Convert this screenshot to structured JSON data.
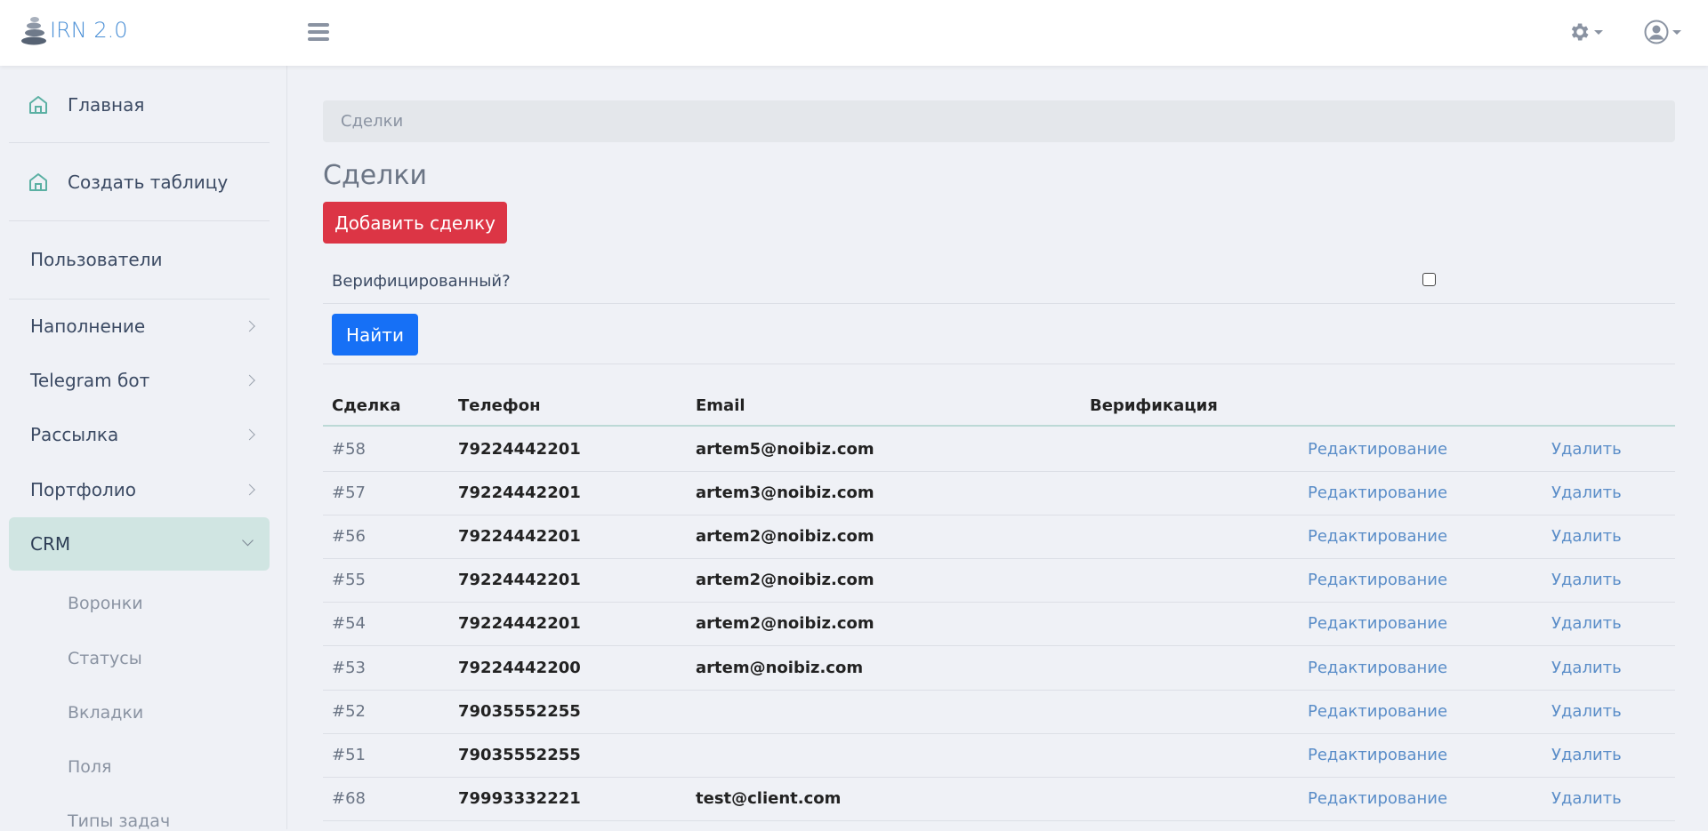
{
  "header": {
    "brand": "IRN 2.0"
  },
  "sidebar": {
    "items": [
      {
        "label": "Главная"
      },
      {
        "label": "Создать таблицу"
      },
      {
        "label": "Пользователи"
      },
      {
        "label": "Наполнение"
      },
      {
        "label": "Telegram бот"
      },
      {
        "label": "Рассылка"
      },
      {
        "label": "Портфолио"
      },
      {
        "label": "CRM"
      }
    ],
    "crm_sub": [
      {
        "label": "Воронки"
      },
      {
        "label": "Статусы"
      },
      {
        "label": "Вкладки"
      },
      {
        "label": "Поля"
      },
      {
        "label": "Типы задач"
      }
    ]
  },
  "main": {
    "breadcrumb": "Сделки",
    "title": "Сделки",
    "add_button": "Добавить сделку",
    "filter_label": "Верифицированный?",
    "filter_checked": false,
    "find_button": "Найти"
  },
  "table": {
    "headers": {
      "deal": "Сделка",
      "phone": "Телефон",
      "email": "Email",
      "verification": "Верификация"
    },
    "rows": [
      {
        "id": "#58",
        "phone": "79224442201",
        "email": "artem5@noibiz.com",
        "edit": "Редактирование",
        "delete": "Удалить"
      },
      {
        "id": "#57",
        "phone": "79224442201",
        "email": "artem3@noibiz.com",
        "edit": "Редактирование",
        "delete": "Удалить"
      },
      {
        "id": "#56",
        "phone": "79224442201",
        "email": "artem2@noibiz.com",
        "edit": "Редактирование",
        "delete": "Удалить"
      },
      {
        "id": "#55",
        "phone": "79224442201",
        "email": "artem2@noibiz.com",
        "edit": "Редактирование",
        "delete": "Удалить"
      },
      {
        "id": "#54",
        "phone": "79224442201",
        "email": "artem2@noibiz.com",
        "edit": "Редактирование",
        "delete": "Удалить"
      },
      {
        "id": "#53",
        "phone": "79224442200",
        "email": "artem@noibiz.com",
        "edit": "Редактирование",
        "delete": "Удалить"
      },
      {
        "id": "#52",
        "phone": "79035552255",
        "email": "",
        "edit": "Редактирование",
        "delete": "Удалить"
      },
      {
        "id": "#51",
        "phone": "79035552255",
        "email": "",
        "edit": "Редактирование",
        "delete": "Удалить"
      },
      {
        "id": "#68",
        "phone": "79993332221",
        "email": "test@client.com",
        "edit": "Редактирование",
        "delete": "Удалить"
      }
    ]
  },
  "colors": {
    "brand": "#4a8fd6",
    "add_button": "#dc3545",
    "find_button": "#1670f6",
    "active_sidebar": "#d0e5e2",
    "link": "#5a8dc8"
  }
}
